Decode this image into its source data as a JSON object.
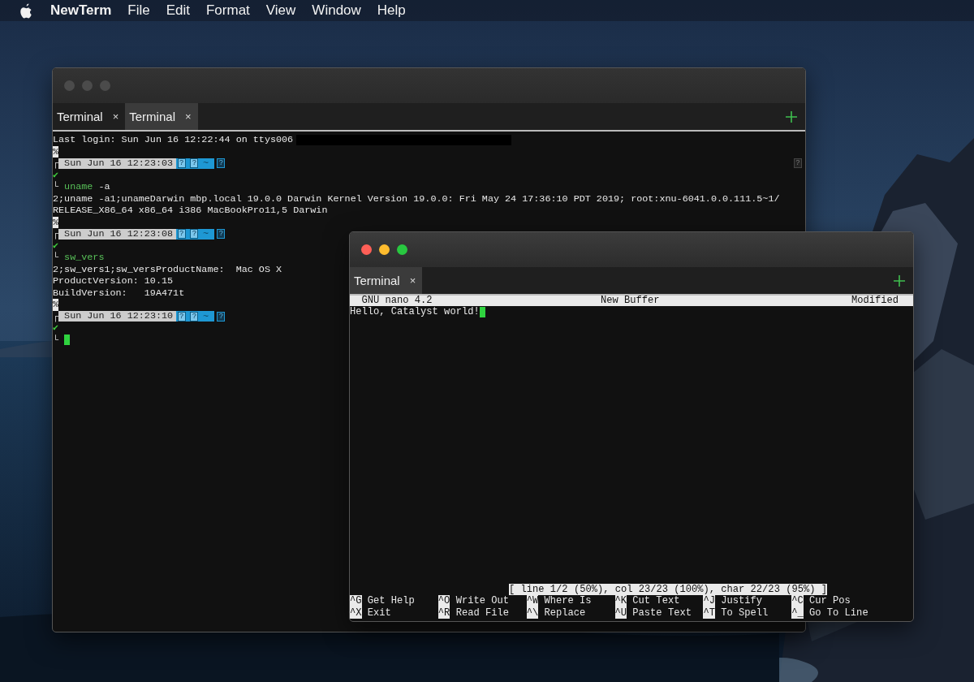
{
  "menu_bar": {
    "app": "NewTerm",
    "items": [
      "File",
      "Edit",
      "Format",
      "View",
      "Window",
      "Help"
    ]
  },
  "windows": [
    {
      "kind": "shell",
      "active": false,
      "tabs": [
        {
          "label": "Terminal",
          "close": "×",
          "selected": false
        },
        {
          "label": "Terminal",
          "close": "×",
          "selected": true
        }
      ],
      "lines": [
        {
          "kind": "output",
          "text": "Last login: Sun Jun 16 12:22:44 on ttys006"
        },
        {
          "kind": "marker",
          "text": "%"
        },
        {
          "kind": "prompt",
          "corner": "┌",
          "time": "Sun Jun 16 12:23:03",
          "path": [
            {
              "text": "?",
              "boxed": true
            },
            {
              "text": "?",
              "boxed": true
            },
            {
              "text": "~",
              "boxed": false
            }
          ],
          "tail": "?",
          "right": "?"
        },
        {
          "kind": "status",
          "text": "✔"
        },
        {
          "kind": "command",
          "corner": "└",
          "command": "uname",
          "args": "-a",
          "cursor": false
        },
        {
          "kind": "output",
          "text": "2;uname -a1;unameDarwin mbp.local 19.0.0 Darwin Kernel Version 19.0.0: Fri May 24 17:36:10 PDT 2019; root:xnu-6041.0.0.111.5~1/"
        },
        {
          "kind": "output",
          "text": "RELEASE_X86_64 x86_64 i386 MacBookPro11,5 Darwin"
        },
        {
          "kind": "marker",
          "text": "%"
        },
        {
          "kind": "prompt",
          "corner": "┌",
          "time": "Sun Jun 16 12:23:08",
          "path": [
            {
              "text": "?",
              "boxed": true
            },
            {
              "text": "?",
              "boxed": true
            },
            {
              "text": "~",
              "boxed": false
            }
          ],
          "tail": "?"
        },
        {
          "kind": "status",
          "text": "✔"
        },
        {
          "kind": "command",
          "corner": "└",
          "command": "sw_vers",
          "cursor": false
        },
        {
          "kind": "output",
          "text": "2;sw_vers1;sw_versProductName:  Mac OS X"
        },
        {
          "kind": "output",
          "text": "ProductVersion: 10.15"
        },
        {
          "kind": "output",
          "text": "BuildVersion:   19A471t"
        },
        {
          "kind": "marker",
          "text": "%"
        },
        {
          "kind": "prompt",
          "corner": "┌",
          "time": "Sun Jun 16 12:23:10",
          "path": [
            {
              "text": "?",
              "boxed": true
            },
            {
              "text": "?",
              "boxed": true
            },
            {
              "text": "~",
              "boxed": false
            }
          ],
          "tail": "?"
        },
        {
          "kind": "status",
          "text": "✔"
        },
        {
          "kind": "command",
          "corner": "└",
          "cursor": true
        }
      ]
    },
    {
      "kind": "nano",
      "active": true,
      "tabs": [
        {
          "label": "Terminal",
          "close": "×",
          "selected": true
        }
      ],
      "nano": {
        "header": {
          "left": "GNU nano 4.2",
          "center": "New Buffer",
          "right": "Modified"
        },
        "buffer": [
          {
            "text": "Hello, Catalyst world!",
            "cursor": true
          }
        ],
        "status": "[ line 1/2 (50%), col 23/23 (100%), char 22/23 (95%) ]",
        "shortcuts": [
          [
            {
              "key": "^G",
              "label": "Get Help"
            },
            {
              "key": "^O",
              "label": "Write Out"
            },
            {
              "key": "^W",
              "label": "Where Is"
            },
            {
              "key": "^K",
              "label": "Cut Text"
            },
            {
              "key": "^J",
              "label": "Justify"
            },
            {
              "key": "^C",
              "label": "Cur Pos"
            }
          ],
          [
            {
              "key": "^X",
              "label": "Exit"
            },
            {
              "key": "^R",
              "label": "Read File"
            },
            {
              "key": "^\\",
              "label": "Replace"
            },
            {
              "key": "^U",
              "label": "Paste Text"
            },
            {
              "key": "^T",
              "label": "To Spell"
            },
            {
              "key": "^_",
              "label": "Go To Line"
            }
          ]
        ]
      }
    }
  ]
}
